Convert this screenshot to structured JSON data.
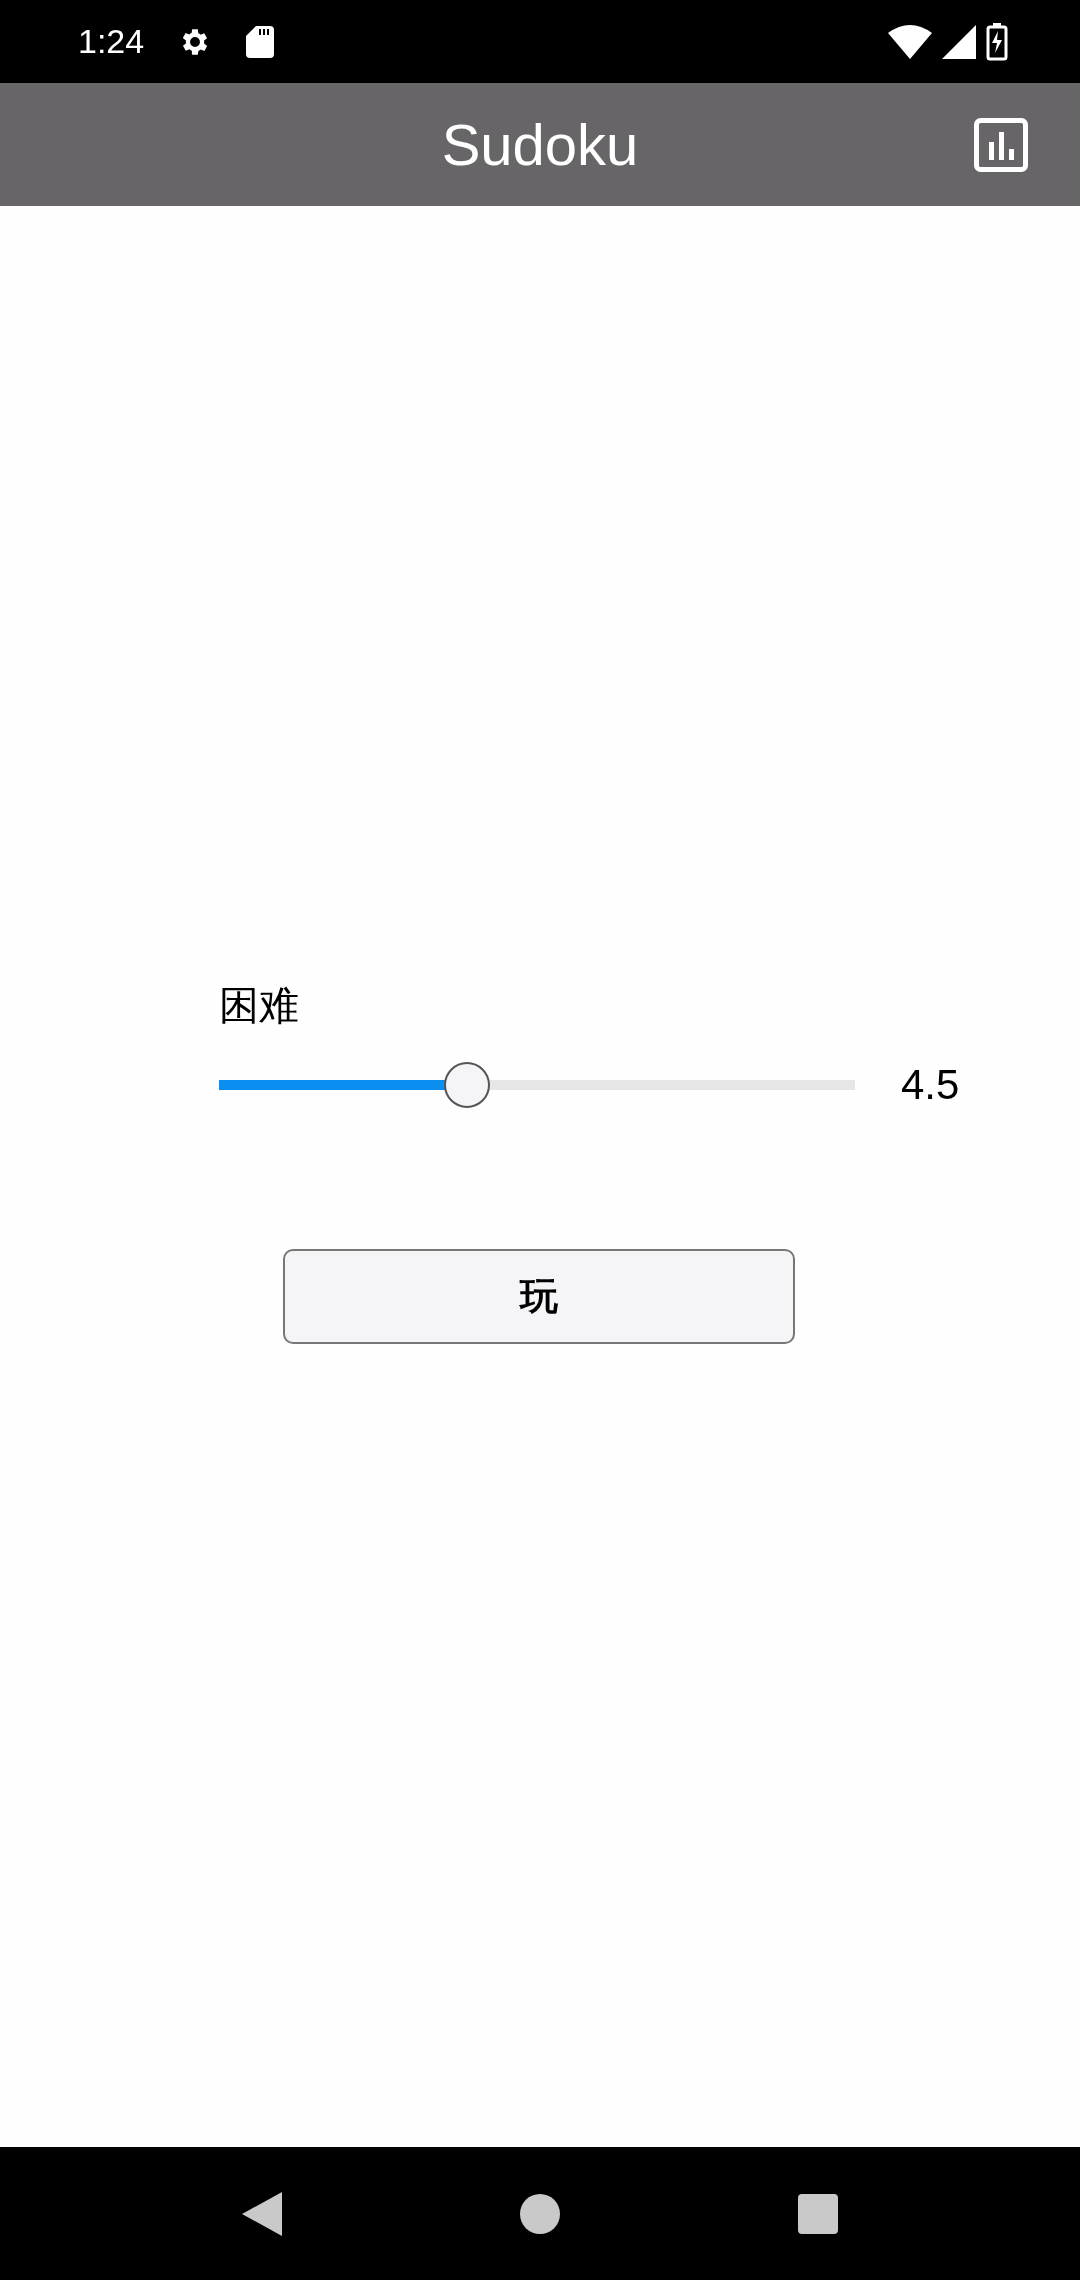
{
  "status_bar": {
    "time": "1:24"
  },
  "app_bar": {
    "title": "Sudoku"
  },
  "difficulty": {
    "label": "困难",
    "level": 0.39,
    "reading": "4.5"
  },
  "buttons": [
    "玩"
  ]
}
